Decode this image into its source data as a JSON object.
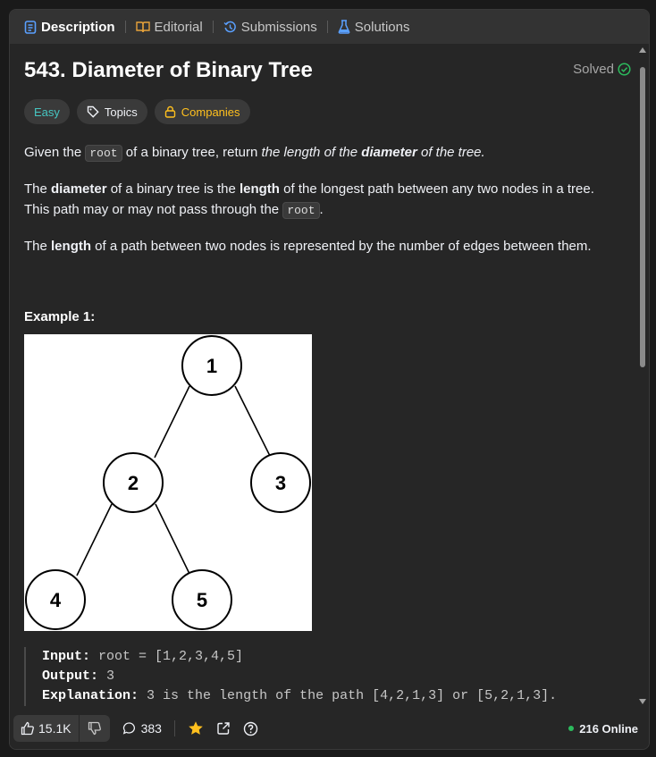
{
  "tabs": [
    {
      "label": "Description",
      "active": true
    },
    {
      "label": "Editorial"
    },
    {
      "label": "Submissions"
    },
    {
      "label": "Solutions"
    }
  ],
  "problem": {
    "title": "543. Diameter of Binary Tree",
    "status": "Solved",
    "tags": {
      "difficulty": "Easy",
      "topics": "Topics",
      "companies": "Companies"
    }
  },
  "description": {
    "p1": {
      "a": "Given the ",
      "code": "root",
      "b": " of a binary tree, return ",
      "c": "the length of the ",
      "d": "diameter",
      "e": " of the tree."
    },
    "p2": {
      "a": "The ",
      "b": "diameter",
      "c": " of a binary tree is the ",
      "d": "length",
      "e": " of the longest path between any two nodes in a tree. This path may or may not pass through the ",
      "code": "root",
      "f": "."
    },
    "p3": {
      "a": "The ",
      "b": "length",
      "c": " of a path between two nodes is represented by the number of edges between them."
    }
  },
  "example1": {
    "title": "Example 1:",
    "tree_nodes": [
      "1",
      "2",
      "3",
      "4",
      "5"
    ],
    "input_label": "Input:",
    "input_value": "root = [1,2,3,4,5]",
    "output_label": "Output:",
    "output_value": "3",
    "explanation_label": "Explanation:",
    "explanation_value": "3 is the length of the path [4,2,1,3] or [5,2,1,3]."
  },
  "footer": {
    "likes": "15.1K",
    "comments": "383",
    "online": "216 Online"
  },
  "colors": {
    "easy": "#46c6c2",
    "companies": "#ffc01e",
    "solved_check": "#2cbb5d",
    "star": "#ffc01e",
    "online_dot": "#2cbb5d"
  }
}
